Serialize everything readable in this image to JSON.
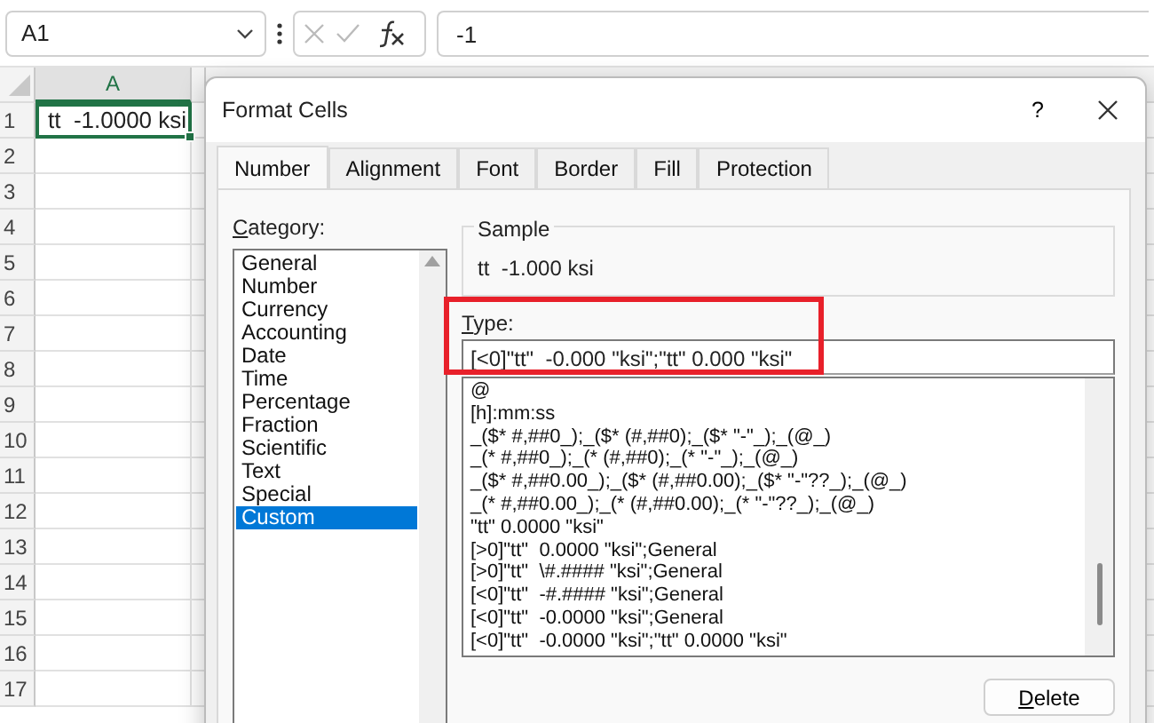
{
  "name_box": {
    "value": "A1"
  },
  "formula_bar": {
    "value": "-1"
  },
  "sheet": {
    "column_header": "A",
    "row_headers": [
      "1",
      "2",
      "3",
      "4",
      "5",
      "6",
      "7",
      "8",
      "9",
      "10",
      "11",
      "12",
      "13",
      "14",
      "15",
      "16",
      "17"
    ],
    "active_cell": {
      "value": "tt  -1.0000 ksi",
      "selected": true
    }
  },
  "dialog": {
    "title": "Format Cells",
    "help": "?",
    "tabs": [
      {
        "label": "Number",
        "selected": true
      },
      {
        "label": "Alignment",
        "selected": false
      },
      {
        "label": "Font",
        "selected": false
      },
      {
        "label": "Border",
        "selected": false
      },
      {
        "label": "Fill",
        "selected": false
      },
      {
        "label": "Protection",
        "selected": false
      }
    ],
    "category_label": "Category:",
    "categories": [
      {
        "label": "General",
        "selected": false
      },
      {
        "label": "Number",
        "selected": false
      },
      {
        "label": "Currency",
        "selected": false
      },
      {
        "label": "Accounting",
        "selected": false
      },
      {
        "label": "Date",
        "selected": false
      },
      {
        "label": "Time",
        "selected": false
      },
      {
        "label": "Percentage",
        "selected": false
      },
      {
        "label": "Fraction",
        "selected": false
      },
      {
        "label": "Scientific",
        "selected": false
      },
      {
        "label": "Text",
        "selected": false
      },
      {
        "label": "Special",
        "selected": false
      },
      {
        "label": "Custom",
        "selected": true
      }
    ],
    "sample": {
      "label": "Sample",
      "value": "tt  -1.000 ksi"
    },
    "type": {
      "label": "Type:",
      "value": "[<0]\"tt\"  -0.000 \"ksi\";\"tt\" 0.000 \"ksi\"",
      "highlighted": true
    },
    "formats": [
      "@",
      "[h]:mm:ss",
      "_($* #,##0_);_($* (#,##0);_($* \"-\"_);_(@_)",
      "_(* #,##0_);_(* (#,##0);_(* \"-\"_);_(@_)",
      "_($* #,##0.00_);_($* (#,##0.00);_($* \"-\"??_);_(@_)",
      "_(* #,##0.00_);_(* (#,##0.00);_(* \"-\"??_);_(@_)",
      "\"tt\" 0.0000 \"ksi\"",
      "[>0]\"tt\"  0.0000 \"ksi\";General",
      "[>0]\"tt\"  \\#.#### \"ksi\";General",
      "[<0]\"tt\"  -#.#### \"ksi\";General",
      "[<0]\"tt\"  -0.0000 \"ksi\";General",
      "[<0]\"tt\"  -0.0000 \"ksi\";\"tt\" 0.0000 \"ksi\""
    ],
    "delete_button": "Delete"
  }
}
